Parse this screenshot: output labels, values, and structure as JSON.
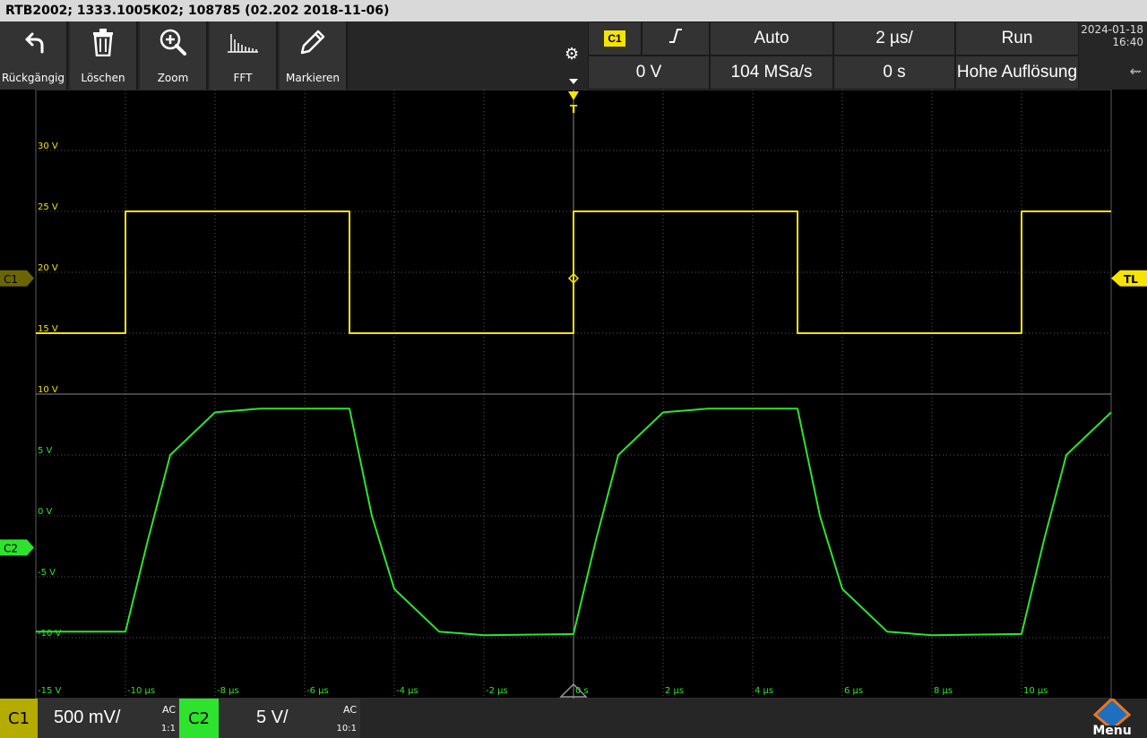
{
  "titlebar": {
    "text": "RTB2002; 1333.1005K02; 108785 (02.202 2018-11-06)"
  },
  "toolbar": {
    "buttons": [
      {
        "label": "Rückgängig",
        "icon": "undo-icon"
      },
      {
        "label": "Löschen",
        "icon": "trash-icon"
      },
      {
        "label": "Zoom",
        "icon": "zoom-icon"
      },
      {
        "label": "FFT",
        "icon": "fft-icon"
      },
      {
        "label": "Markieren",
        "icon": "pencil-icon"
      }
    ]
  },
  "status": {
    "trigger_source": "C1",
    "trigger_edge": "rising-edge-icon",
    "trigger_mode": "Auto",
    "timebase": "2 µs/",
    "run_state": "Run",
    "trigger_level": "0 V",
    "sample_rate": "104 MSa/s",
    "time_offset": "0 s",
    "acquisition": "Hohe Auflösung"
  },
  "datetime": {
    "date": "2024-01-18",
    "time": "16:40"
  },
  "scope": {
    "y_labels": [
      "30 V",
      "25 V",
      "20 V",
      "15 V",
      "10 V",
      "5 V",
      "0 V",
      "-5 V",
      "-10 V",
      "-15 V"
    ],
    "x_labels": [
      "-10 µs",
      "-8 µs",
      "-6 µs",
      "-4 µs",
      "-2 µs",
      "0 s",
      "2 µs",
      "4 µs",
      "6 µs",
      "8 µs",
      "10 µs"
    ],
    "c1_marker": "C1",
    "c2_marker": "C2",
    "trigger_level_marker": "TL",
    "trigger_marker": "T",
    "colors": {
      "c1": "#f5e400",
      "c2": "#2ee32e",
      "grid": "#5a5a5a"
    }
  },
  "channels": {
    "c1": {
      "tag": "C1",
      "scale": "500 mV/",
      "coupling": "AC",
      "probe": "1:1"
    },
    "c2": {
      "tag": "C2",
      "scale": "5 V/",
      "coupling": "AC",
      "probe": "10:1"
    }
  },
  "menu": {
    "label": "Menu",
    "logo": "rohde-schwarz-logo"
  },
  "chart_data": {
    "type": "line",
    "xlabel": "",
    "ylabel": "",
    "xlim": [
      -12,
      12
    ],
    "ylim": [
      -15,
      35
    ],
    "grid": true,
    "series": [
      {
        "name": "C1",
        "x": [
          -12,
          -10,
          -10,
          -5,
          -5,
          0,
          0,
          5,
          5,
          10,
          10,
          12
        ],
        "y": [
          15,
          15,
          25,
          25,
          15,
          15,
          25,
          25,
          15,
          15,
          25,
          25
        ]
      },
      {
        "name": "C2",
        "x": [
          -12,
          -10,
          -9.5,
          -9,
          -8,
          -7,
          -5,
          -4.5,
          -4,
          -3,
          -2,
          0,
          0.5,
          1,
          2,
          3,
          5,
          5.5,
          6,
          7,
          8,
          10,
          10.5,
          11,
          12
        ],
        "y": [
          -9.5,
          -9.5,
          -2,
          5,
          8.5,
          8.8,
          8.8,
          0,
          -6,
          -9.5,
          -9.8,
          -9.7,
          -2,
          5,
          8.5,
          8.8,
          8.8,
          0,
          -6,
          -9.5,
          -9.8,
          -9.7,
          -2,
          5,
          8.5
        ]
      }
    ]
  }
}
